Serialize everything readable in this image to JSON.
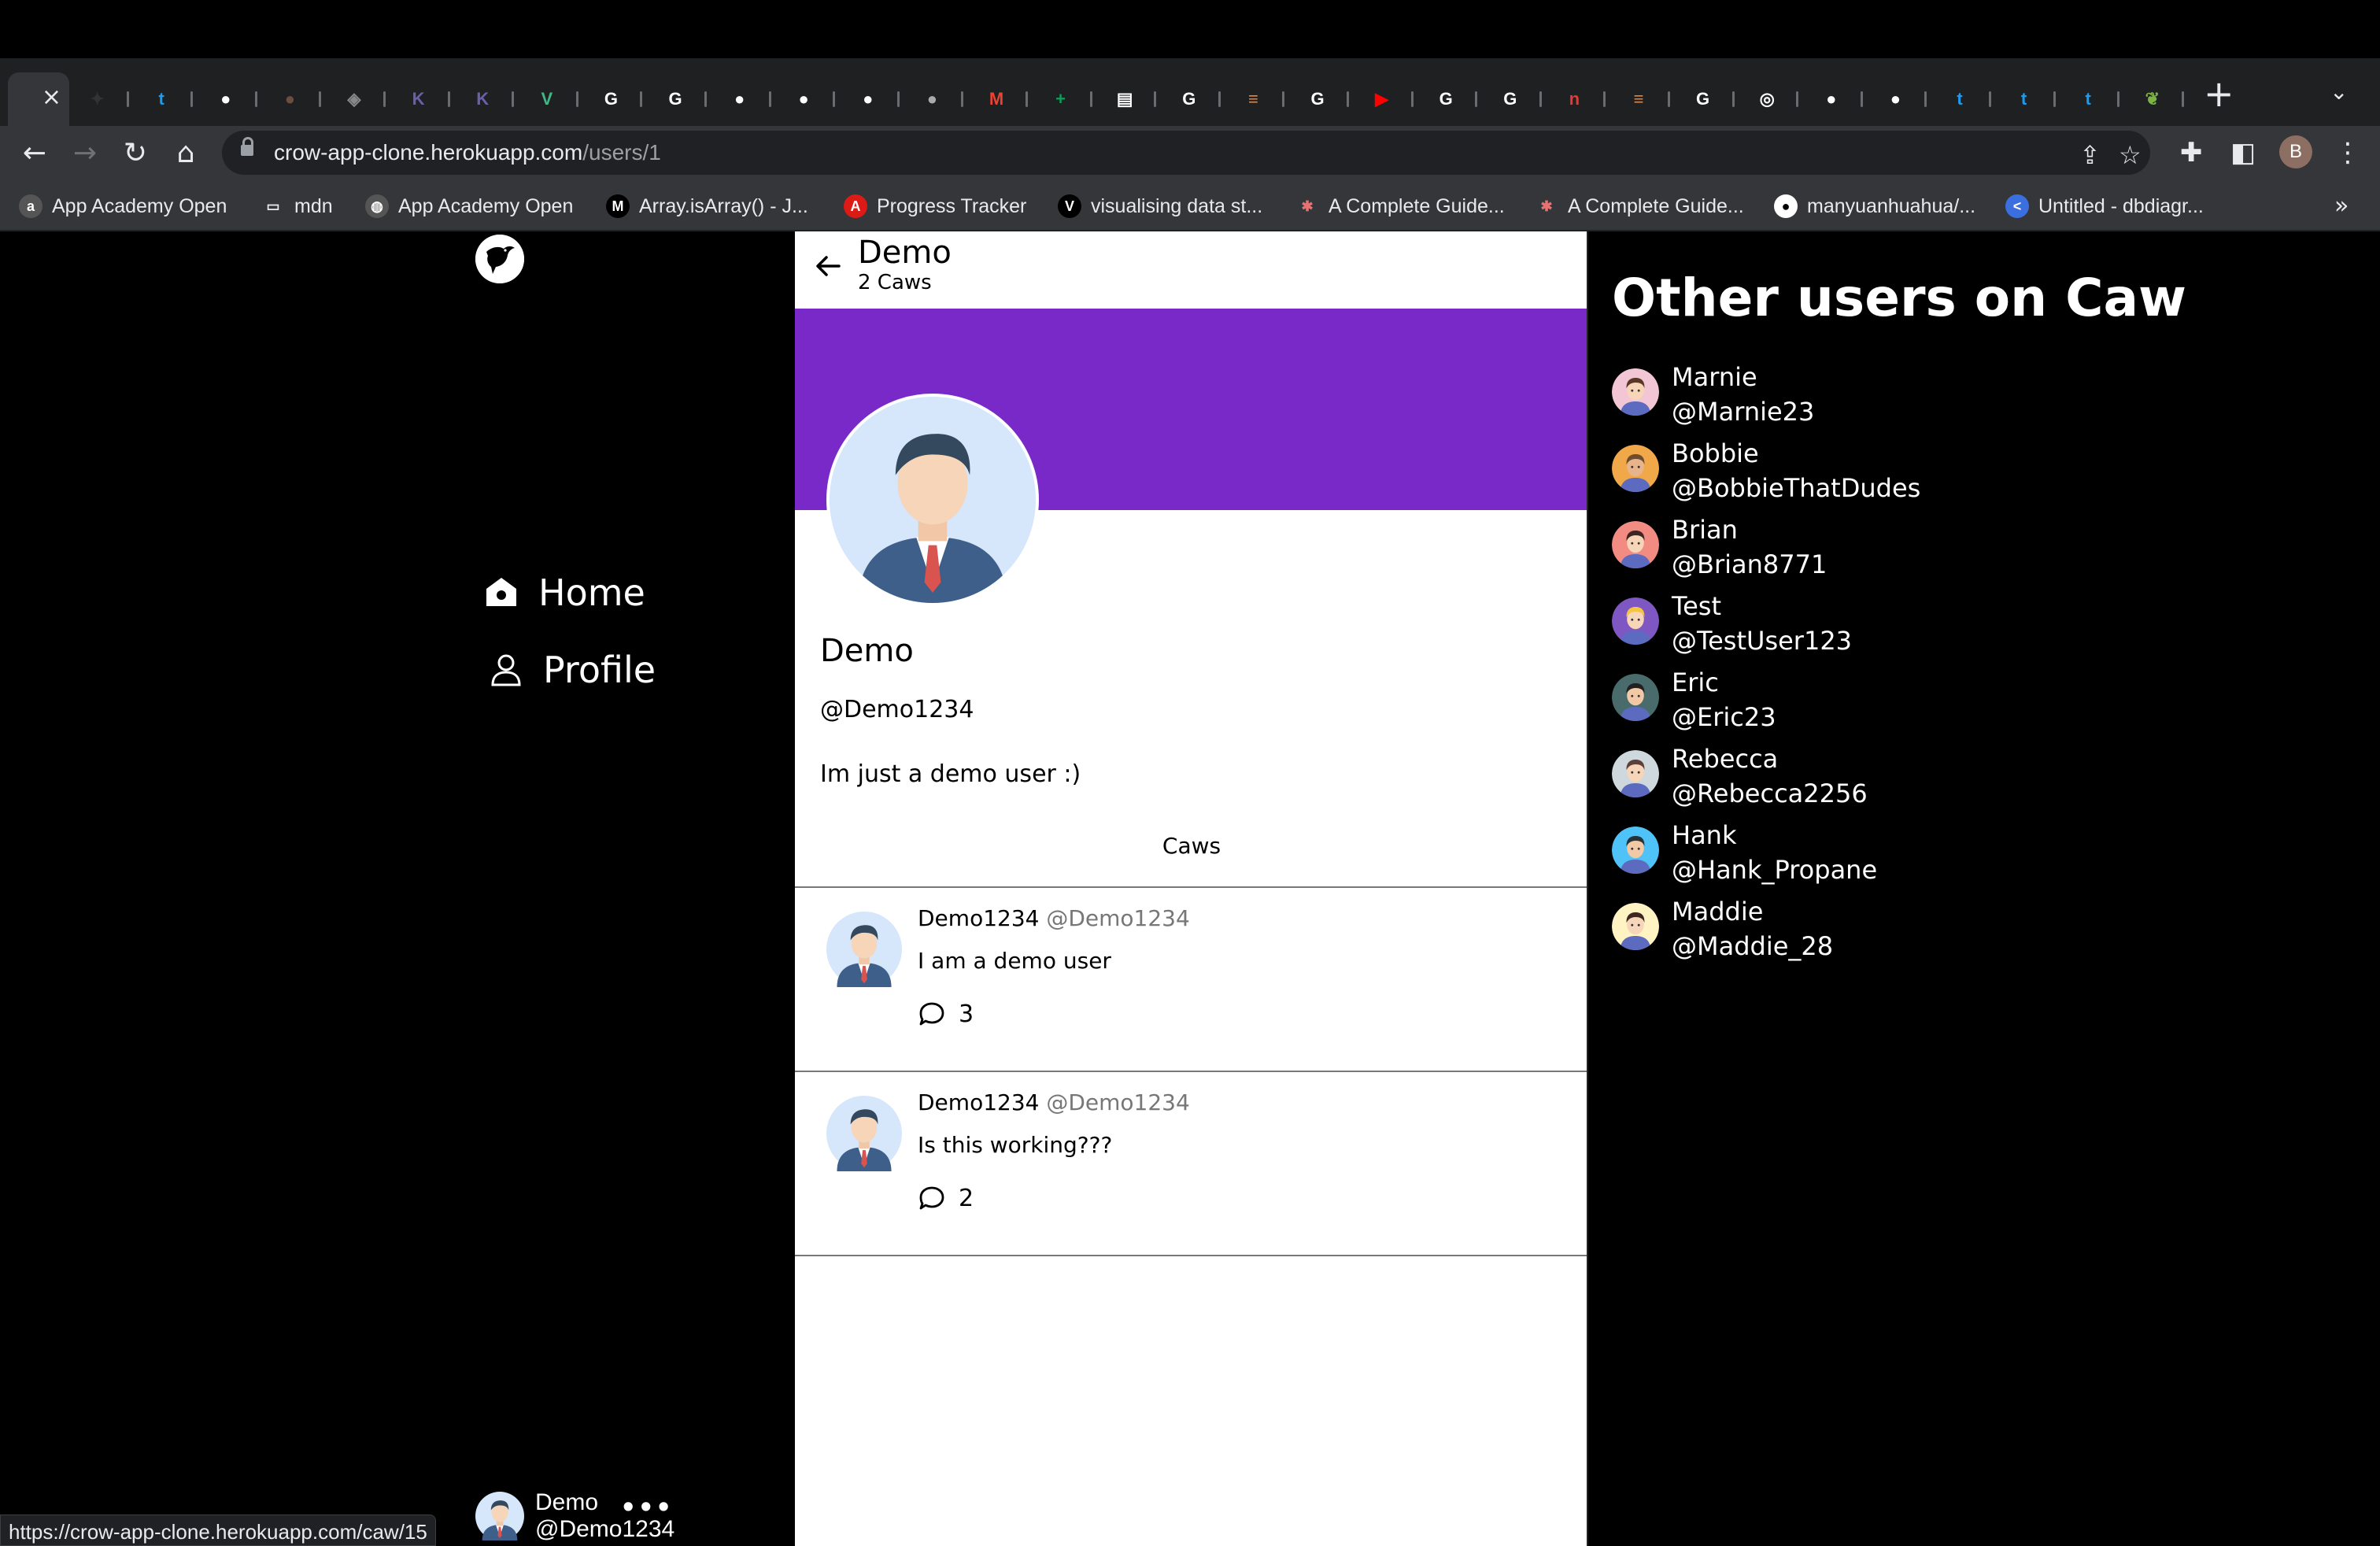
{
  "browser": {
    "url_host": "crow-app-clone.herokuapp.com",
    "url_path": "/users/1",
    "profile_initial": "B",
    "tabs": [
      {
        "icon": "loading-icon",
        "color": "#35363a",
        "glyph": "C"
      },
      {
        "icon": "bird-icon",
        "color": "#333",
        "glyph": "✦"
      },
      {
        "icon": "twitter-icon",
        "color": "#1d9bf0",
        "glyph": "t"
      },
      {
        "icon": "github-icon",
        "color": "#fff",
        "glyph": "●"
      },
      {
        "icon": "avatar-icon",
        "color": "#6d4c41",
        "glyph": "●"
      },
      {
        "icon": "cube-icon",
        "color": "#888",
        "glyph": "◈"
      },
      {
        "icon": "heroku-icon",
        "color": "#6762a6",
        "glyph": "K"
      },
      {
        "icon": "heroku-icon",
        "color": "#6762a6",
        "glyph": "K"
      },
      {
        "icon": "vue-icon",
        "color": "#41b883",
        "glyph": "V"
      },
      {
        "icon": "google-icon",
        "color": "#fff",
        "glyph": "G"
      },
      {
        "icon": "google-icon",
        "color": "#fff",
        "glyph": "G"
      },
      {
        "icon": "github-icon",
        "color": "#fff",
        "glyph": "●"
      },
      {
        "icon": "github-icon",
        "color": "#fff",
        "glyph": "●"
      },
      {
        "icon": "github-icon",
        "color": "#fff",
        "glyph": "●"
      },
      {
        "icon": "apple-icon",
        "color": "#aaa",
        "glyph": "●"
      },
      {
        "icon": "gmail-icon",
        "color": "#ea4335",
        "glyph": "M"
      },
      {
        "icon": "sheets-icon",
        "color": "#0f9d58",
        "glyph": "+"
      },
      {
        "icon": "page-icon",
        "color": "#fff",
        "glyph": "▤"
      },
      {
        "icon": "google-icon",
        "color": "#fff",
        "glyph": "G"
      },
      {
        "icon": "stackoverflow-icon",
        "color": "#f48024",
        "glyph": "≡"
      },
      {
        "icon": "google-icon",
        "color": "#fff",
        "glyph": "G"
      },
      {
        "icon": "youtube-icon",
        "color": "#ff0000",
        "glyph": "▶"
      },
      {
        "icon": "google-icon",
        "color": "#fff",
        "glyph": "G"
      },
      {
        "icon": "google-icon",
        "color": "#fff",
        "glyph": "G"
      },
      {
        "icon": "readme-icon",
        "color": "#e53935",
        "glyph": "n"
      },
      {
        "icon": "stackoverflow-icon",
        "color": "#f48024",
        "glyph": "≡"
      },
      {
        "icon": "google-icon",
        "color": "#fff",
        "glyph": "G"
      },
      {
        "icon": "chrome-icon",
        "color": "#fff",
        "glyph": "◎"
      },
      {
        "icon": "github-icon",
        "color": "#fff",
        "glyph": "●"
      },
      {
        "icon": "github-icon",
        "color": "#fff",
        "glyph": "●"
      },
      {
        "icon": "twitter-icon",
        "color": "#1d9bf0",
        "glyph": "t"
      },
      {
        "icon": "twitter-icon",
        "color": "#1d9bf0",
        "glyph": "t"
      },
      {
        "icon": "twitter-icon",
        "color": "#1d9bf0",
        "glyph": "t"
      },
      {
        "icon": "leaf-icon",
        "color": "#7cb342",
        "glyph": "❦"
      }
    ],
    "bookmarks": [
      {
        "label": "App Academy Open",
        "icon": "appacademy-icon",
        "color": "#555",
        "glyph": "a"
      },
      {
        "label": "mdn",
        "icon": "folder-icon",
        "color": "transparent",
        "glyph": "▭"
      },
      {
        "label": "App Academy Open",
        "icon": "globe-icon",
        "color": "#555",
        "glyph": "◍"
      },
      {
        "label": "Array.isArray() - J...",
        "icon": "mdn-icon",
        "color": "#000",
        "glyph": "M"
      },
      {
        "label": "Progress Tracker",
        "icon": "angular-icon",
        "color": "#dd1b16",
        "glyph": "A"
      },
      {
        "label": "visualising data st...",
        "icon": "visualgo-icon",
        "color": "#000",
        "glyph": "V"
      },
      {
        "label": "A Complete Guide...",
        "icon": "asterisk-icon",
        "color": "transparent",
        "glyph": "✱"
      },
      {
        "label": "A Complete Guide...",
        "icon": "asterisk-icon",
        "color": "transparent",
        "glyph": "✱"
      },
      {
        "label": "manyuanhuahua/...",
        "icon": "github-icon",
        "color": "#fff",
        "glyph": "●"
      },
      {
        "label": "Untitled - dbdiagr...",
        "icon": "dbdiagram-icon",
        "color": "#3b6fe0",
        "glyph": "<"
      }
    ]
  },
  "nav": {
    "home_label": "Home",
    "profile_label": "Profile"
  },
  "current_user": {
    "name": "Demo",
    "handle": "@Demo1234"
  },
  "status_url": "https://crow-app-clone.herokuapp.com/caw/15",
  "profile": {
    "header_title": "Demo",
    "header_sub": "2 Caws",
    "name": "Demo",
    "handle": "@Demo1234",
    "bio": "Im just a demo user :)",
    "tab_label": "Caws",
    "banner_color": "#7829c8"
  },
  "caws": [
    {
      "author": "Demo1234",
      "handle": "@Demo1234",
      "text": "I am a demo user",
      "comments": "3"
    },
    {
      "author": "Demo1234",
      "handle": "@Demo1234",
      "text": "Is this working???",
      "comments": "2"
    }
  ],
  "sidebar_right": {
    "title": "Other users on Caw",
    "users": [
      {
        "name": "Marnie",
        "handle": "@Marnie23",
        "avatar_color": "#f3c6d6",
        "skin": "#f6d5b8",
        "hair": "#5a3825"
      },
      {
        "name": "Bobbie",
        "handle": "@BobbieThatDudes",
        "avatar_color": "#f0a848",
        "skin": "#e8b48c",
        "hair": "#6d4c2f"
      },
      {
        "name": "Brian",
        "handle": "@Brian8771",
        "avatar_color": "#f28b82",
        "skin": "#f6d5b8",
        "hair": "#3e2723"
      },
      {
        "name": "Test",
        "handle": "@TestUser123",
        "avatar_color": "#7e57c2",
        "skin": "#f6d5b8",
        "hair": "#f4c542"
      },
      {
        "name": "Eric",
        "handle": "@Eric23",
        "avatar_color": "#4a6b6b",
        "skin": "#f2c9a6",
        "hair": "#212121"
      },
      {
        "name": "Rebecca",
        "handle": "@Rebecca2256",
        "avatar_color": "#cfd8dc",
        "skin": "#f6d5b8",
        "hair": "#5d4037"
      },
      {
        "name": "Hank",
        "handle": "@Hank_Propane",
        "avatar_color": "#4fc3f7",
        "skin": "#f2c9a6",
        "hair": "#263238"
      },
      {
        "name": "Maddie",
        "handle": "@Maddie_28",
        "avatar_color": "#fff3c4",
        "skin": "#f6d5b8",
        "hair": "#3e2723"
      }
    ]
  }
}
